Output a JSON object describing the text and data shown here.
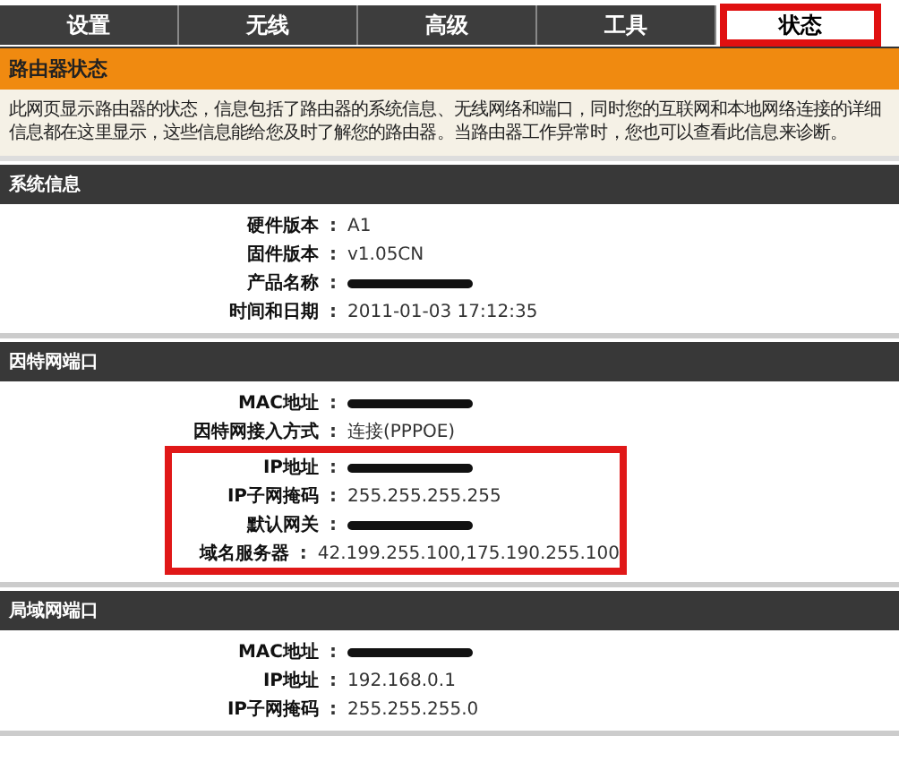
{
  "tabs": [
    {
      "label": "设置",
      "selected": false
    },
    {
      "label": "无线",
      "selected": false
    },
    {
      "label": "高级",
      "selected": false
    },
    {
      "label": "工具",
      "selected": false
    },
    {
      "label": "状态",
      "selected": true
    }
  ],
  "page": {
    "title": "路由器状态",
    "description": "此网页显示路由器的状态，信息包括了路由器的系统信息、无线网络和端口，同时您的互联网和本地网络连接的详细信息都在这里显示，这些信息能给您及时了解您的路由器。当路由器工作异常时，您也可以查看此信息来诊断。"
  },
  "sections": [
    {
      "title": "系统信息",
      "rows": [
        {
          "label": "硬件版本",
          "sep": ":",
          "value": "A1",
          "redacted": false,
          "highlighted": false
        },
        {
          "label": "固件版本",
          "sep": ":",
          "value": "v1.05CN",
          "redacted": false,
          "highlighted": false
        },
        {
          "label": "产品名称",
          "sep": ":",
          "redacted": true,
          "highlighted": false
        },
        {
          "label": "时间和日期",
          "sep": ":",
          "value": "2011-01-03 17:12:35",
          "redacted": false,
          "highlighted": false
        }
      ]
    },
    {
      "title": "因特网端口",
      "rows": [
        {
          "label": "MAC地址",
          "sep": ":",
          "redacted": true,
          "highlighted": false
        },
        {
          "label": "因特网接入方式",
          "sep": ":",
          "value": "连接(PPPOE)",
          "redacted": false,
          "highlighted": false
        },
        {
          "label": "IP地址",
          "sep": ":",
          "redacted": true,
          "highlighted": true
        },
        {
          "label": "IP子网掩码",
          "sep": ":",
          "value": "255.255.255.255",
          "redacted": false,
          "highlighted": true
        },
        {
          "label": "默认网关",
          "sep": ":",
          "redacted": true,
          "highlighted": true
        },
        {
          "label": "域名服务器",
          "sep": ":",
          "value": "42.199.255.100,175.190.255.100",
          "redacted": false,
          "highlighted": true
        }
      ]
    },
    {
      "title": "局域网端口",
      "rows": [
        {
          "label": "MAC地址",
          "sep": ":",
          "redacted": true,
          "highlighted": false
        },
        {
          "label": "IP地址",
          "sep": ":",
          "value": "192.168.0.1",
          "redacted": false,
          "highlighted": false
        },
        {
          "label": "IP子网掩码",
          "sep": ":",
          "value": "255.255.255.0",
          "redacted": false,
          "highlighted": false
        }
      ]
    }
  ]
}
